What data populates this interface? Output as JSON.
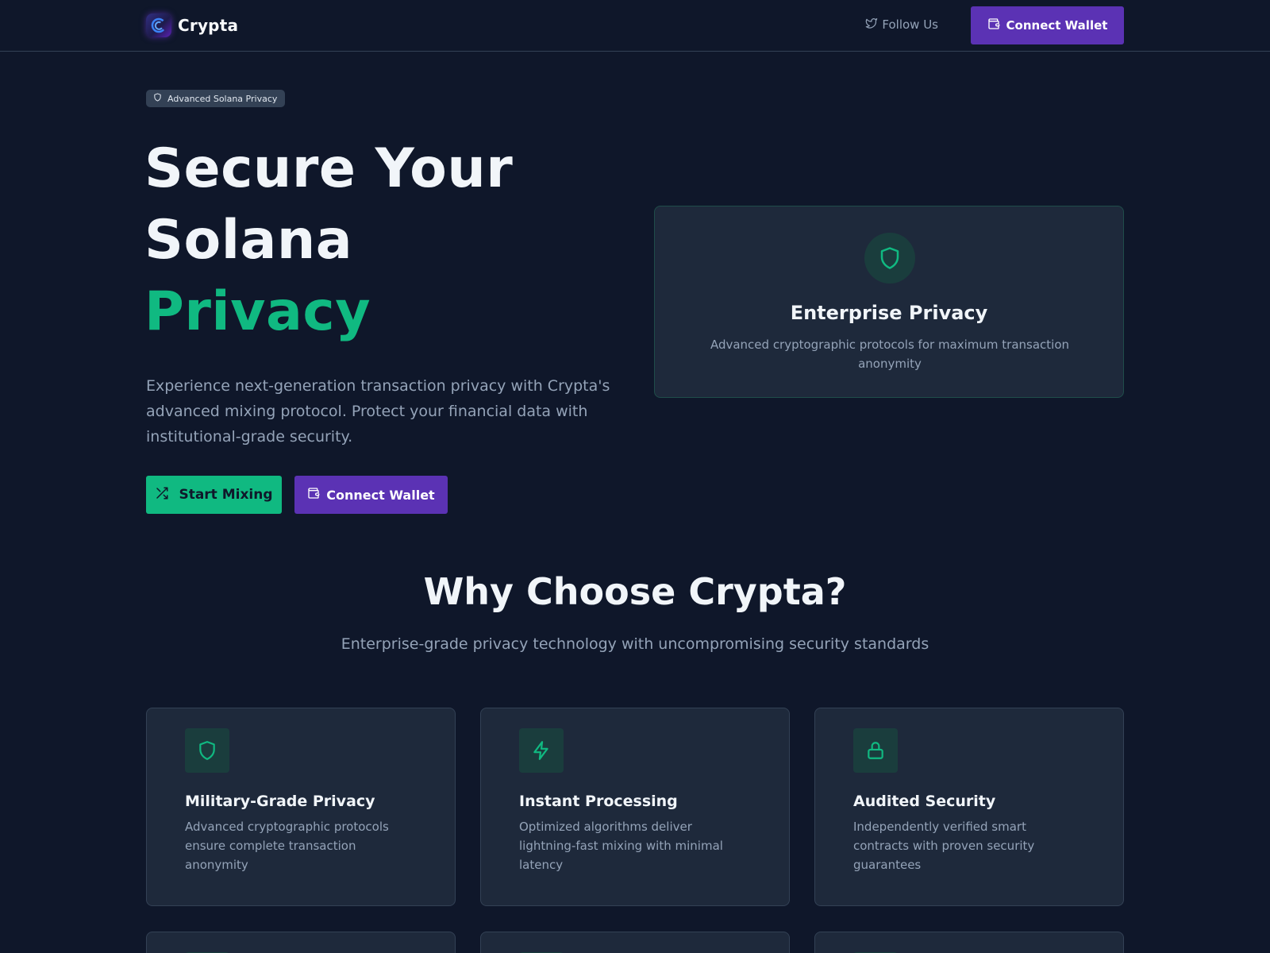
{
  "header": {
    "brand": "Crypta",
    "follow_label": "Follow Us",
    "connect_label": "Connect Wallet"
  },
  "hero": {
    "badge": "Advanced Solana Privacy",
    "title_line1": "Secure Your",
    "title_line2": "Solana",
    "title_accent": "Privacy",
    "description": "Experience next-generation transaction privacy with Crypta's advanced mixing protocol. Protect your financial data with institutional-grade security.",
    "start_label": "Start Mixing",
    "connect_label": "Connect Wallet"
  },
  "enterprise": {
    "title": "Enterprise Privacy",
    "description": "Advanced cryptographic protocols for maximum transaction anonymity"
  },
  "why": {
    "title": "Why Choose Crypta?",
    "subtitle": "Enterprise-grade privacy technology with uncompromising security standards",
    "features": [
      {
        "icon": "shield-icon",
        "title": "Military-Grade Privacy",
        "description": "Advanced cryptographic protocols ensure complete transaction anonymity"
      },
      {
        "icon": "lightning-icon",
        "title": "Instant Processing",
        "description": "Optimized algorithms deliver lightning-fast mixing with minimal latency"
      },
      {
        "icon": "lock-icon",
        "title": "Audited Security",
        "description": "Independently verified smart contracts with proven security guarantees"
      }
    ]
  },
  "colors": {
    "background": "#0f172a",
    "accent_green": "#10b981",
    "accent_purple": "#5b32b4",
    "card": "#1e293b"
  }
}
